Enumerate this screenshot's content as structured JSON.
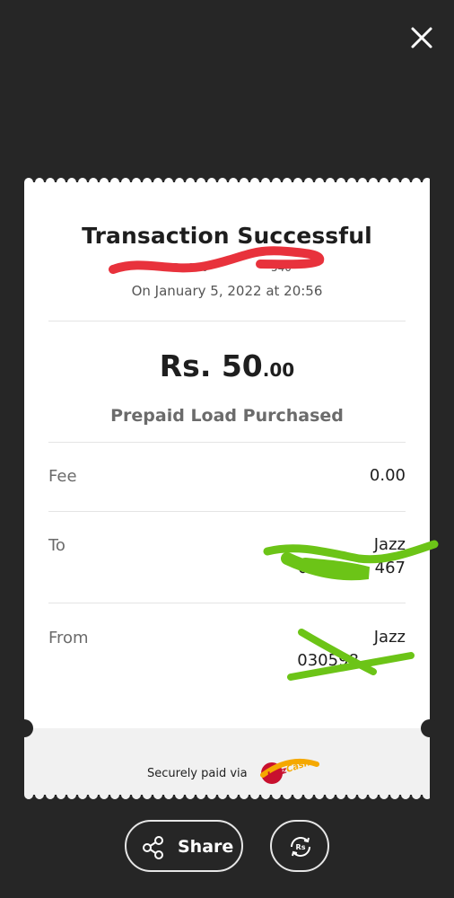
{
  "receipt": {
    "title": "Transaction Successful",
    "tid_label": "TID: 020",
    "tid_tail": "540",
    "date": "On January 5, 2022 at 20:56",
    "amount_main": "Rs. 50",
    "amount_decimal": ".00",
    "purpose": "Prepaid Load Purchased",
    "rows": [
      {
        "label": "Fee",
        "value": "0.00"
      },
      {
        "label": "To",
        "network": "Jazz",
        "number_head": "0305",
        "number_tail": "467"
      },
      {
        "label": "From",
        "network": "Jazz",
        "number_head": "030598",
        "number_tail": ""
      }
    ],
    "footer_text": "Securely paid via",
    "logo_text": "JazzCash"
  },
  "actions": {
    "share_label": "Share"
  },
  "icons": {
    "close": "close-icon",
    "share": "share-icon",
    "reload": "reload-currency-icon",
    "logo": "jazzcash-logo"
  },
  "colors": {
    "background": "#262626",
    "card": "#ffffff",
    "redaction_red": "#e8323c",
    "redaction_green": "#6cc417",
    "logo_red": "#c8102e",
    "logo_yellow": "#f5a800"
  }
}
